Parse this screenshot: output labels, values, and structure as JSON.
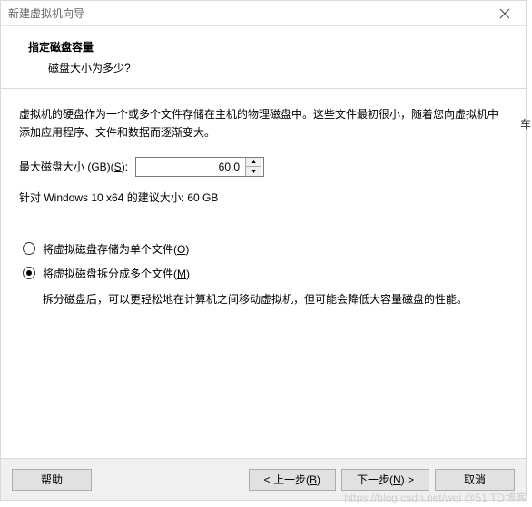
{
  "window": {
    "title": "新建虚拟机向导"
  },
  "header": {
    "title": "指定磁盘容量",
    "subtitle": "磁盘大小为多少?"
  },
  "content": {
    "description": "虚拟机的硬盘作为一个或多个文件存储在主机的物理磁盘中。这些文件最初很小，随着您向虚拟机中添加应用程序、文件和数据而逐渐变大。",
    "disk_label_pre": "最大磁盘大小 (GB)(",
    "disk_label_key": "S",
    "disk_label_post": "):",
    "disk_value": "60.0",
    "recommended": "针对 Windows 10 x64 的建议大小: 60 GB",
    "radio1_pre": "将虚拟磁盘存储为单个文件(",
    "radio1_key": "O",
    "radio1_post": ")",
    "radio2_pre": "将虚拟磁盘拆分成多个文件(",
    "radio2_key": "M",
    "radio2_post": ")",
    "radio_hint": "拆分磁盘后，可以更轻松地在计算机之间移动虚拟机，但可能会降低大容量磁盘的性能。"
  },
  "buttons": {
    "help": "帮助",
    "back_pre": "< 上一步(",
    "back_key": "B",
    "back_post": ")",
    "next_pre": "下一步(",
    "next_key": "N",
    "next_post": ") >",
    "cancel": "取消"
  },
  "watermark": "https://blog.csdn.net/wei @51 TD博客",
  "edge": "车"
}
